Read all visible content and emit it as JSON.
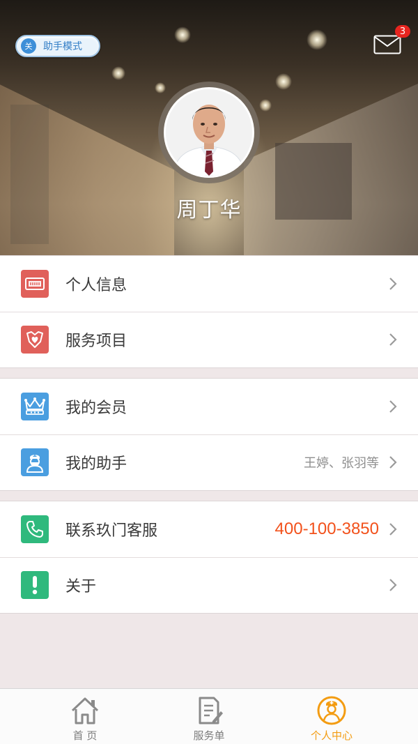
{
  "header": {
    "helper_toggle": {
      "state": "关",
      "label": "助手模式"
    },
    "mail_badge": "3",
    "doctor_name": "周丁华"
  },
  "menu": {
    "group1": [
      {
        "label": "个人信息",
        "icon": "id-card-icon",
        "icon_color": "#e0605a"
      },
      {
        "label": "服务项目",
        "icon": "heart-shield-icon",
        "icon_color": "#e0605a"
      }
    ],
    "group2": [
      {
        "label": "我的会员",
        "icon": "crown-icon",
        "icon_color": "#4a9ee0"
      },
      {
        "label": "我的助手",
        "value": "王婷、张羽等",
        "icon": "nurse-icon",
        "icon_color": "#4a9ee0"
      }
    ],
    "group3": [
      {
        "label": "联系玖门客服",
        "value": "400-100-3850",
        "icon": "phone-icon",
        "icon_color": "#2fb97d"
      },
      {
        "label": "关于",
        "icon": "exclamation-icon",
        "icon_color": "#2fb97d"
      }
    ]
  },
  "tabbar": {
    "tabs": [
      {
        "label": "首 页",
        "icon": "home-icon",
        "active": false
      },
      {
        "label": "服务单",
        "icon": "document-edit-icon",
        "active": false
      },
      {
        "label": "个人中心",
        "icon": "person-center-icon",
        "active": true
      }
    ],
    "active_color": "#f39c12",
    "inactive_color": "#7c7c7c"
  }
}
